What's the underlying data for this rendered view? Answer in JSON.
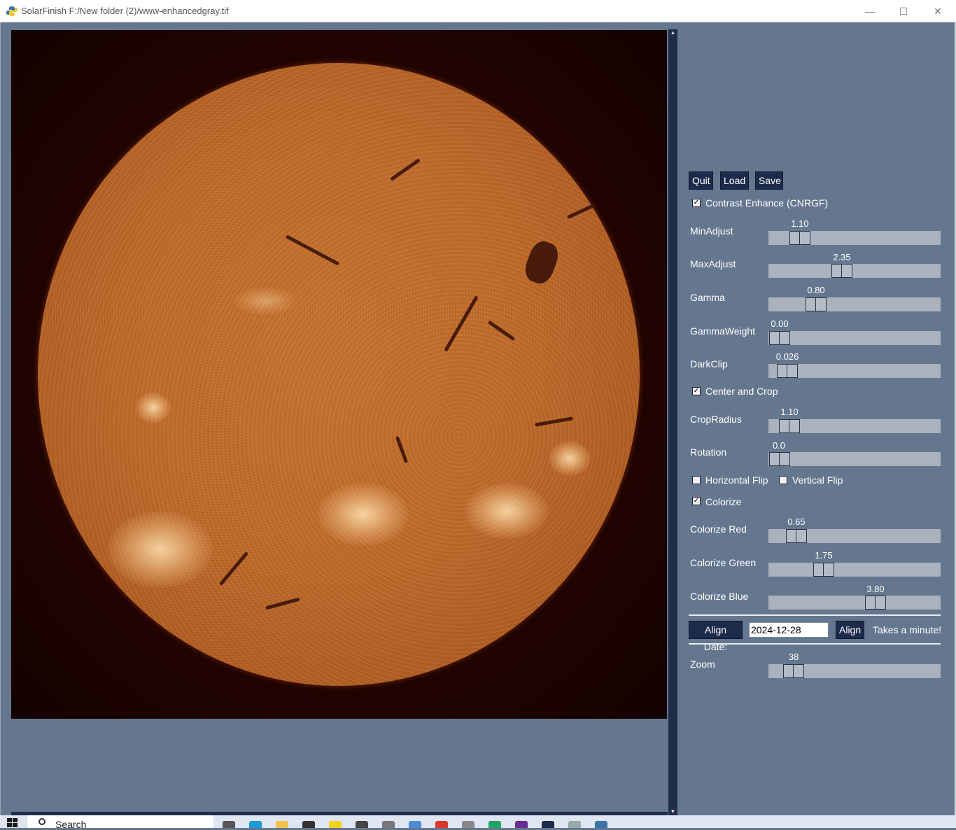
{
  "window": {
    "title": "SolarFinish F:/New folder (2)/www-enhancedgray.tif",
    "minimize": "—",
    "maximize": "☐",
    "close": "✕"
  },
  "buttons": {
    "quit": "Quit",
    "load": "Load",
    "save": "Save"
  },
  "contrast_enhance": {
    "label": "Contrast Enhance (CNRGF)",
    "checked": true
  },
  "sliders": {
    "min_adjust": {
      "label": "MinAdjust",
      "value": "1.10"
    },
    "max_adjust": {
      "label": "MaxAdjust",
      "value": "2.35"
    },
    "gamma": {
      "label": "Gamma",
      "value": "0.80"
    },
    "gamma_weight": {
      "label": "GammaWeight",
      "value": "0.00"
    },
    "dark_clip": {
      "label": "DarkClip",
      "value": "0.026"
    },
    "crop_radius": {
      "label": "CropRadius",
      "value": "1.10"
    },
    "rotation": {
      "label": "Rotation",
      "value": "0.0"
    },
    "colorize_red": {
      "label": "Colorize Red",
      "value": "0.65"
    },
    "colorize_green": {
      "label": "Colorize Green",
      "value": "1.75"
    },
    "colorize_blue": {
      "label": "Colorize Blue",
      "value": "3.80"
    },
    "zoom": {
      "label": "Zoom",
      "value": "38"
    }
  },
  "center_and_crop": {
    "label": "Center and Crop",
    "checked": true
  },
  "horizontal_flip": {
    "label": "Horizontal Flip",
    "checked": false
  },
  "vertical_flip": {
    "label": "Vertical Flip",
    "checked": false
  },
  "colorize": {
    "label": "Colorize",
    "checked": true
  },
  "align": {
    "date_button": "Align Date:",
    "date_value": "2024-12-28",
    "align_button": "Align",
    "hint": "Takes a minute!"
  },
  "taskbar": {
    "search_placeholder": "Search"
  },
  "colors": {
    "panel_bg": "#64778f",
    "button_bg": "#1d2b4b",
    "slider_track": "#a9b2bd",
    "sun": "#bf6a2a"
  }
}
